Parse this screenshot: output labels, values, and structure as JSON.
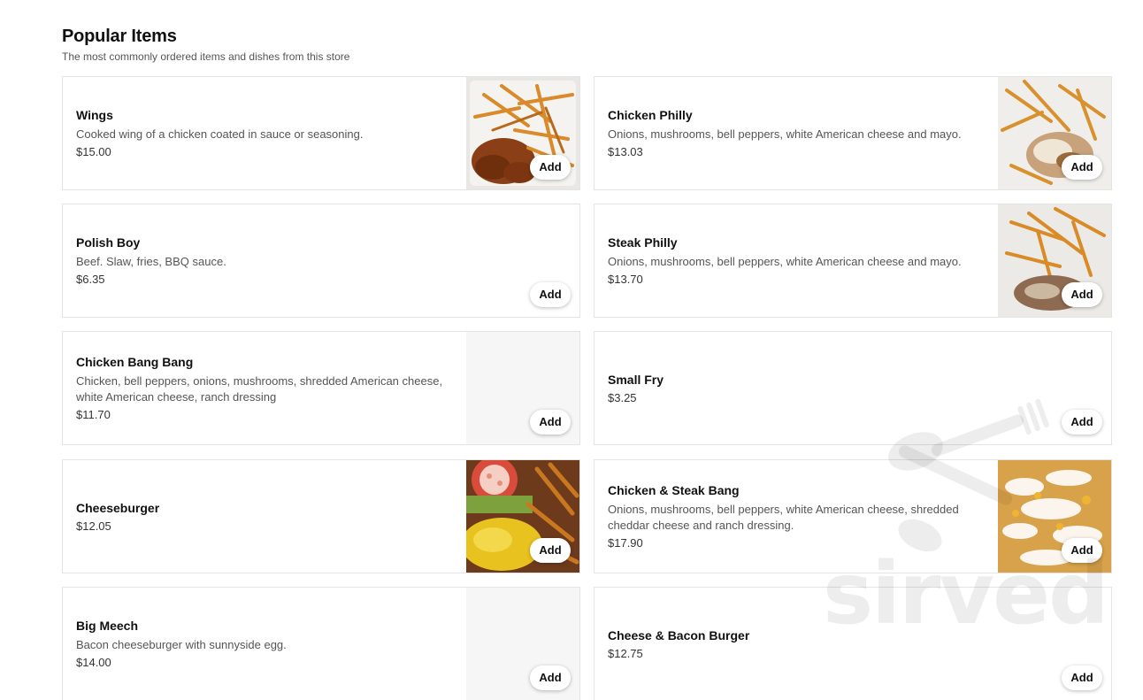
{
  "section": {
    "title": "Popular Items",
    "subtitle": "The most commonly ordered items and dishes from this store"
  },
  "add_label": "Add",
  "watermark": "sirved",
  "items": [
    {
      "name": "Wings",
      "description": "Cooked wing of a chicken coated in sauce or seasoning.",
      "price": "$15.00",
      "image": "wings-with-fries"
    },
    {
      "name": "Chicken Philly",
      "description": "Onions, mushrooms, bell peppers, white American cheese and mayo.",
      "price": "$13.03",
      "image": "chicken-philly-with-fries"
    },
    {
      "name": "Polish Boy",
      "description": "Beef. Slaw, fries, BBQ sauce.",
      "price": "$6.35",
      "image": ""
    },
    {
      "name": "Steak Philly",
      "description": "Onions, mushrooms, bell peppers, white American cheese and mayo.",
      "price": "$13.70",
      "image": "steak-philly-with-fries"
    },
    {
      "name": "Chicken Bang Bang",
      "description": "Chicken, bell peppers, onions, mushrooms, shredded American cheese, white American cheese, ranch dressing",
      "price": "$11.70",
      "image": "placeholder"
    },
    {
      "name": "Small Fry",
      "description": "",
      "price": "$3.25",
      "image": ""
    },
    {
      "name": "Cheeseburger",
      "description": "",
      "price": "$12.05",
      "image": "cheeseburger-with-fries"
    },
    {
      "name": "Chicken & Steak Bang",
      "description": "Onions, mushrooms, bell peppers, white American cheese, shredded cheddar cheese and ranch dressing.",
      "price": "$17.90",
      "image": "loaded-fries"
    },
    {
      "name": "Big Meech",
      "description": "Bacon cheeseburger with sunnyside egg.",
      "price": "$14.00",
      "image": "placeholder"
    },
    {
      "name": "Cheese & Bacon Burger",
      "description": "",
      "price": "$12.75",
      "image": ""
    }
  ]
}
